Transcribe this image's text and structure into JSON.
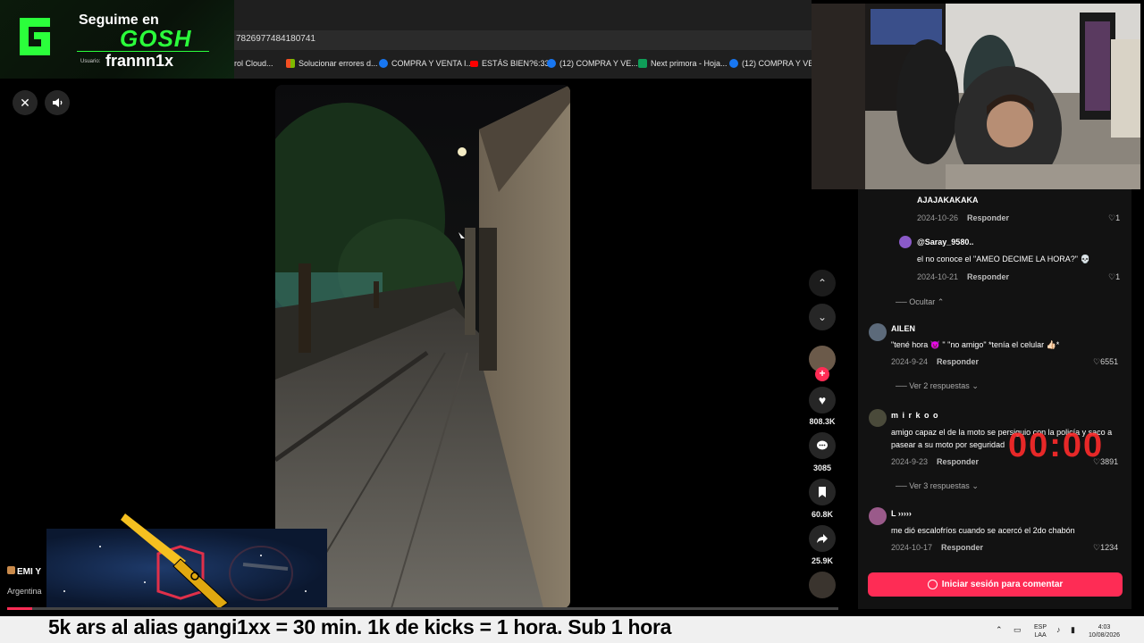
{
  "overlay": {
    "follow_prefix": "Seguime en",
    "platform": "GOSH",
    "user_label": "Usuario:",
    "username": "frannn1x"
  },
  "browser": {
    "url_fragment": "7826977484180741",
    "bookmarks": [
      {
        "label": "rol Cloud...",
        "color": "#888888"
      },
      {
        "label": "Solucionar errores d...",
        "color": "#f2b400"
      },
      {
        "label": "COMPRA Y VENTA I...",
        "color": "#1877f2"
      },
      {
        "label": "ESTÁS BIEN?6:33",
        "color": "#ff0000"
      },
      {
        "label": "(12) COMPRA Y VE...",
        "color": "#1877f2"
      },
      {
        "label": "Next primora - Hoja...",
        "color": "#0f9d58"
      },
      {
        "label": "(12) COMPRA Y VE...",
        "color": "#1877f2"
      }
    ]
  },
  "player": {
    "close_icon": "close-icon",
    "volume_icon": "volume-icon"
  },
  "actions": {
    "likes": "808.3K",
    "comments": "3085",
    "saves": "60.8K",
    "shares": "25.9K"
  },
  "comments": {
    "items": [
      {
        "user": "",
        "text": "AJAJAKAKAKA",
        "date": "2024-10-26",
        "reply": "Responder",
        "likes": "1"
      },
      {
        "user": "@Saray_9580..",
        "text": "el no conoce el \"AMEO DECIME LA HORA?\" 💀",
        "date": "2024-10-21",
        "reply": "Responder",
        "likes": "1"
      },
      {
        "user": "AILEN",
        "text": "\"tené hora 👿 \" \"no amigo\" *tenía el celular 👍🏻*",
        "date": "2024-9-24",
        "reply": "Responder",
        "likes": "6551"
      },
      {
        "user": "m i r k o o",
        "text": "amigo capaz el de la moto se persiguio con la policía y saco a pasear a su moto por seguridad",
        "date": "2024-9-23",
        "reply": "Responder",
        "likes": "3891"
      },
      {
        "user": "L ›››››",
        "text": "me dió escalofríos cuando se acercó el 2do chabón",
        "date": "2024-10-17",
        "reply": "Responder",
        "likes": "1234"
      }
    ],
    "hide_label": "Ocultar",
    "view_replies_1": "Ver 2 respuestas",
    "view_replies_2": "Ver 3 respuestas",
    "login_label": "Iniciar sesión para comentar"
  },
  "timer": "00:00",
  "uploader": {
    "name": "EMI Y",
    "country": "Argentina"
  },
  "ticker": "5k ars al alias gangi1xx = 30 min. 1k de kicks = 1 hora. Sub 1 hora",
  "taskbar": {
    "lang": "ESP",
    "lang2": "LAA",
    "time": "4:03",
    "date": "10/08/2026"
  },
  "colors": {
    "accent": "#fe2c55",
    "gosh_green": "#2bff3b",
    "timer_red": "#ff2b2b"
  },
  "progress": 0.03
}
